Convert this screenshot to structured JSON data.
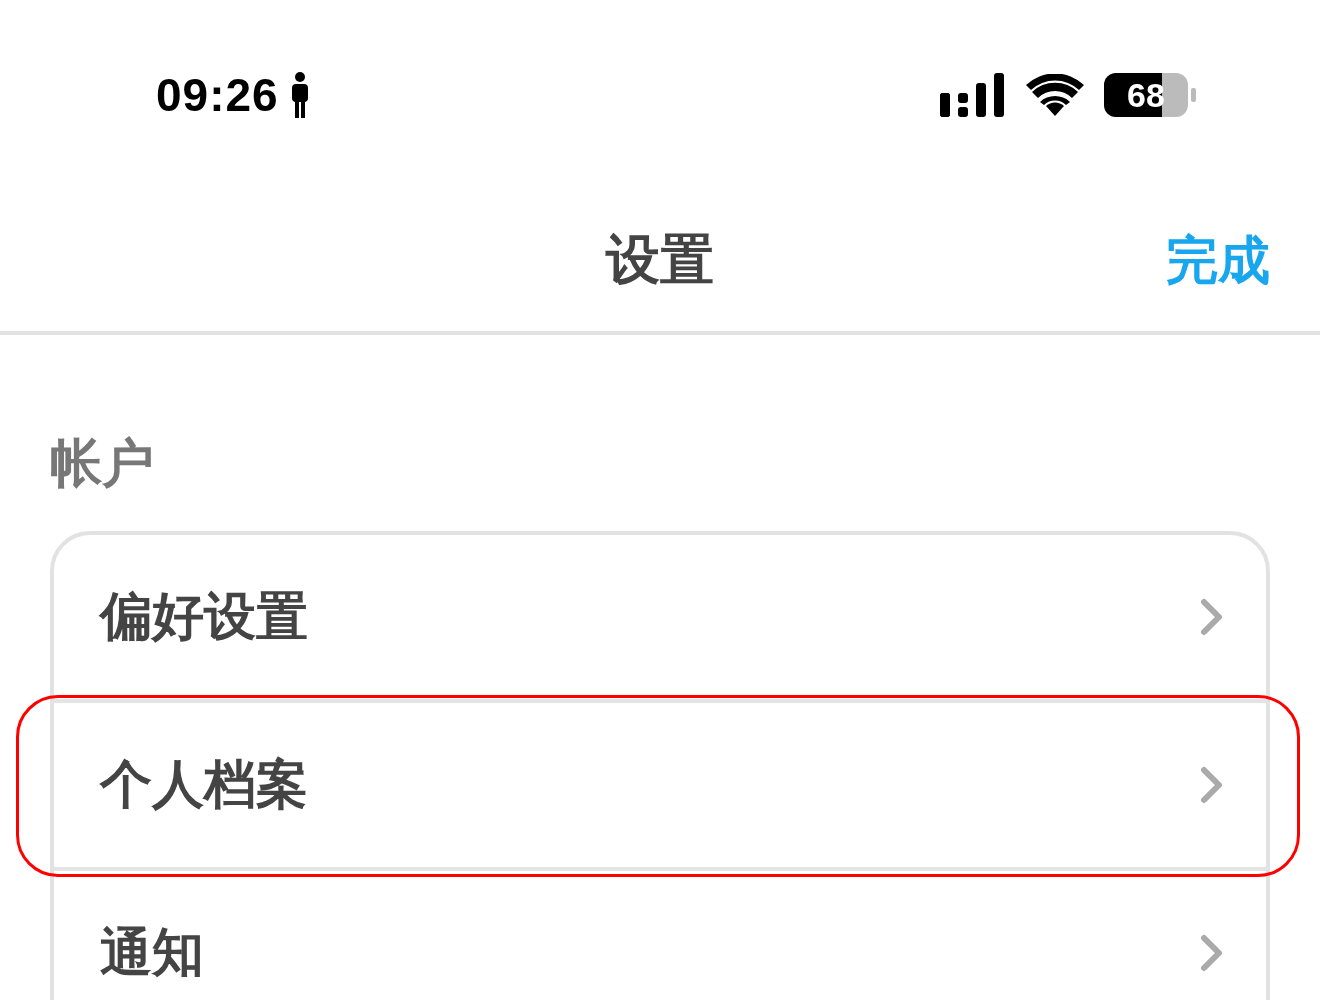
{
  "status_bar": {
    "time": "09:26",
    "battery": "68"
  },
  "nav_bar": {
    "title": "设置",
    "done": "完成"
  },
  "sections": [
    {
      "header": "帐户",
      "items": [
        {
          "label": "偏好设置",
          "highlighted": false
        },
        {
          "label": "个人档案",
          "highlighted": true
        },
        {
          "label": "通知",
          "highlighted": false
        }
      ]
    }
  ]
}
